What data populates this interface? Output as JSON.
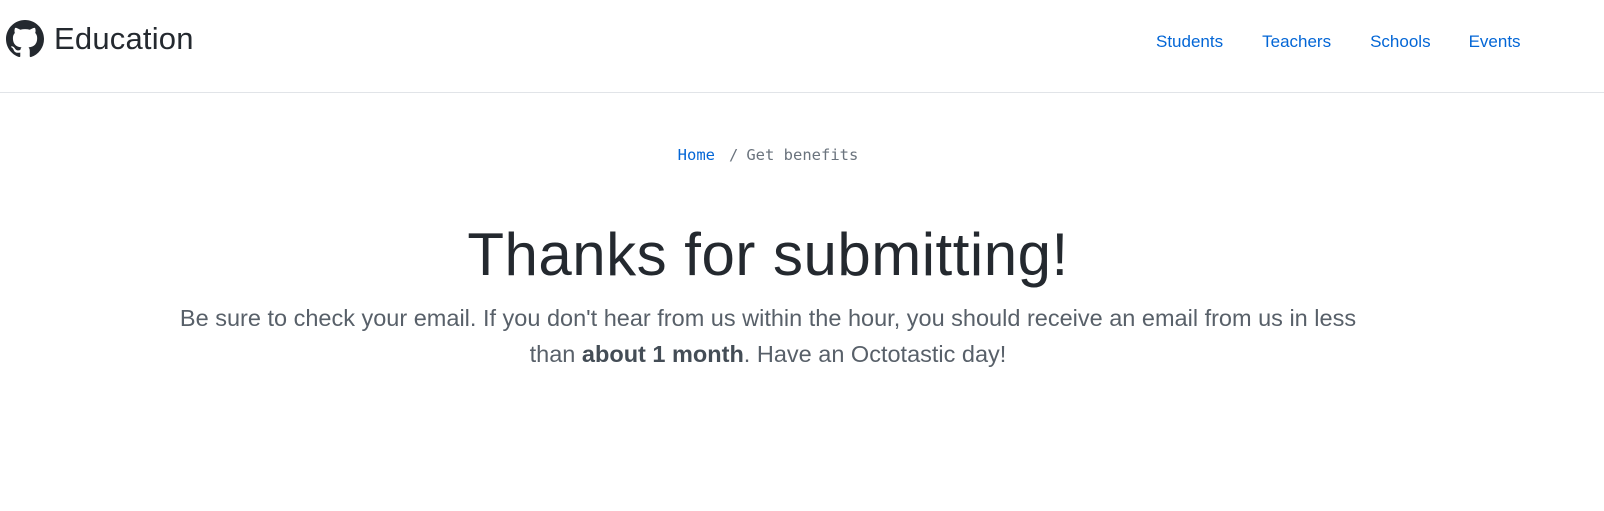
{
  "header": {
    "brand": {
      "logo_icon": "github-octocat-icon",
      "name": "Education"
    },
    "nav": [
      {
        "label": "Students"
      },
      {
        "label": "Teachers"
      },
      {
        "label": "Schools"
      },
      {
        "label": "Events"
      }
    ]
  },
  "breadcrumb": {
    "home": "Home",
    "separator": "/",
    "current": "Get benefits"
  },
  "main": {
    "title": "Thanks for submitting!",
    "message_before": "Be sure to check your email. If you don't hear from us within the hour, you should receive an email from us in less than ",
    "message_bold": "about 1 month",
    "message_after": ". Have an Octotastic day!"
  },
  "colors": {
    "link": "#0366d6",
    "text": "#24292f",
    "muted": "#586069",
    "border": "#e1e4e8"
  }
}
